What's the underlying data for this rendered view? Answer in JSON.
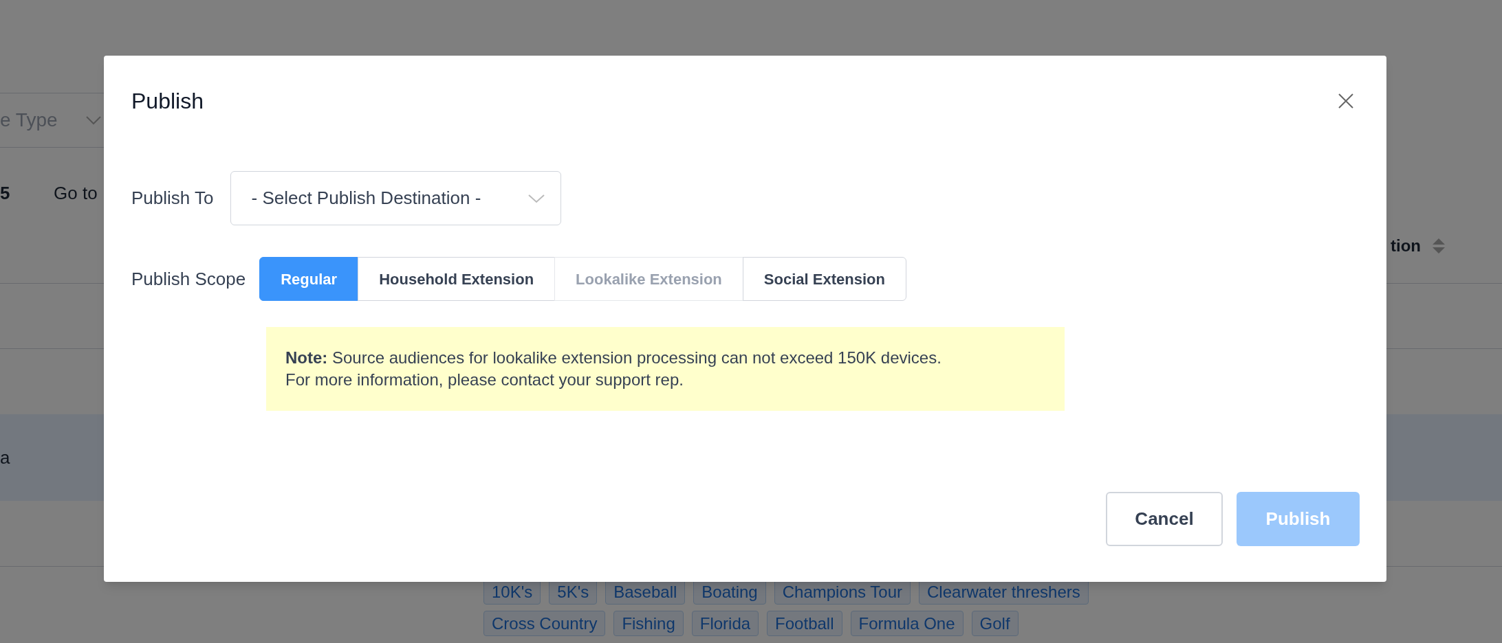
{
  "background": {
    "filter_label": "e Type",
    "page_count": "5",
    "goto_label": "Go to",
    "row_text": "a",
    "column_header": "tion",
    "tags": [
      "10K's",
      "5K's",
      "Baseball",
      "Boating",
      "Champions Tour",
      "Clearwater threshers",
      "Cross Country",
      "Fishing",
      "Florida",
      "Football",
      "Formula One",
      "Golf"
    ]
  },
  "dialog": {
    "title": "Publish",
    "publish_to": {
      "label": "Publish To",
      "placeholder": "- Select Publish Destination -"
    },
    "publish_scope": {
      "label": "Publish Scope",
      "options": [
        {
          "label": "Regular",
          "selected": true,
          "disabled": false
        },
        {
          "label": "Household Extension",
          "selected": false,
          "disabled": false
        },
        {
          "label": "Lookalike Extension",
          "selected": false,
          "disabled": true
        },
        {
          "label": "Social Extension",
          "selected": false,
          "disabled": false
        }
      ]
    },
    "note": "**Note:** Source audiences for lookalike extension processing can not exceed 150K devices. For more information, please contact your support rep.",
    "buttons": [
      {
        "label": "Cancel",
        "kind": "secondary",
        "disabled": false
      },
      {
        "label": "Publish",
        "kind": "primary",
        "disabled": true
      }
    ]
  }
}
